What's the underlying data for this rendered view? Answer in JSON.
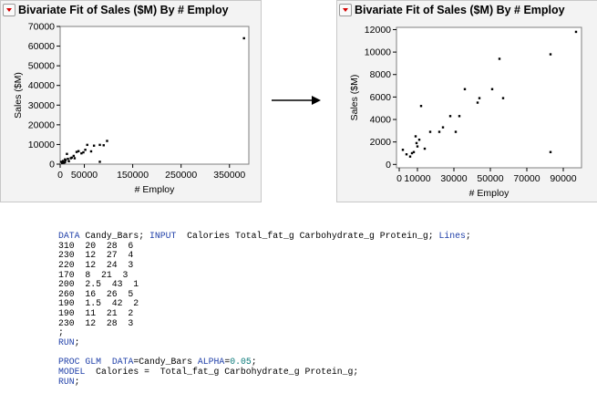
{
  "chart_data": [
    {
      "type": "scatter",
      "title": "Bivariate Fit of Sales ($M) By # Employ",
      "xlabel": "# Employ",
      "ylabel": "Sales ($M)",
      "xlim": [
        0,
        390000
      ],
      "ylim": [
        0,
        70000
      ],
      "xticks": [
        0,
        50000,
        150000,
        250000,
        350000
      ],
      "xtick_labels": [
        "0",
        "50000",
        "150000",
        "250000",
        "350000"
      ],
      "yticks": [
        0,
        10000,
        20000,
        30000,
        40000,
        50000,
        60000,
        70000
      ],
      "ytick_labels": [
        "0",
        "10000",
        "20000",
        "30000",
        "40000",
        "50000",
        "60000",
        "70000"
      ],
      "grid": false,
      "series": [
        {
          "x": [
            2000,
            4000,
            5000,
            6000,
            8000,
            10000,
            10000,
            11000,
            14000,
            16000,
            18000,
            22000,
            24000,
            28000,
            30000,
            34000,
            38000,
            44000,
            48000,
            52000,
            56000,
            64000,
            70000,
            82000,
            82000,
            90000,
            97000,
            380000
          ],
          "y": [
            1200,
            600,
            800,
            1600,
            700,
            1000,
            2400,
            2000,
            5200,
            2700,
            1500,
            3000,
            3300,
            4200,
            3000,
            6200,
            6600,
            5500,
            6000,
            7300,
            9800,
            6500,
            9400,
            9800,
            1200,
            9600,
            11800,
            64000
          ]
        }
      ]
    },
    {
      "type": "scatter",
      "title": "Bivariate Fit of Sales ($M) By # Employ",
      "xlabel": "# Employ",
      "ylabel": "Sales ($M)",
      "xlim": [
        -1500,
        100000
      ],
      "ylim": [
        -300,
        12200
      ],
      "xticks": [
        0,
        10000,
        30000,
        50000,
        70000,
        90000
      ],
      "xtick_labels": [
        "0",
        "10000",
        "30000",
        "50000",
        "70000",
        "90000"
      ],
      "yticks": [
        0,
        2000,
        4000,
        6000,
        8000,
        10000,
        12000
      ],
      "ytick_labels": [
        "0",
        "2000",
        "4000",
        "6000",
        "8000",
        "10000",
        "12000"
      ],
      "grid": false,
      "series": [
        {
          "x": [
            2000,
            4000,
            6000,
            7000,
            8000,
            9000,
            9500,
            10000,
            11000,
            12000,
            14000,
            17000,
            22000,
            24000,
            28000,
            31000,
            33000,
            36000,
            43000,
            44000,
            51000,
            55000,
            57000,
            83000,
            83000,
            97000
          ],
          "y": [
            1300,
            900,
            700,
            1000,
            1100,
            2500,
            1900,
            1600,
            2200,
            5200,
            1400,
            2900,
            2900,
            3300,
            4300,
            2900,
            4300,
            6700,
            5500,
            5900,
            6700,
            9400,
            5900,
            9800,
            1100,
            11800
          ]
        }
      ]
    }
  ],
  "arrow": {
    "name": "transform-arrow"
  },
  "code_lines": [
    [
      [
        "kw",
        "DATA"
      ],
      [
        "t",
        " Candy_Bars; "
      ],
      [
        "kw",
        "INPUT"
      ],
      [
        "t",
        "  Calories Total_fat_g Carbohydrate_g Protein_g; "
      ],
      [
        "kw",
        "Lines"
      ],
      [
        "t",
        ";"
      ]
    ],
    [
      [
        "t",
        "310  20  28  6"
      ]
    ],
    [
      [
        "t",
        "230  12  27  4"
      ]
    ],
    [
      [
        "t",
        "220  12  24  3"
      ]
    ],
    [
      [
        "t",
        "170  8  21  3"
      ]
    ],
    [
      [
        "t",
        "200  2.5  43  1"
      ]
    ],
    [
      [
        "t",
        "260  16  26  5"
      ]
    ],
    [
      [
        "t",
        "190  1.5  42  2"
      ]
    ],
    [
      [
        "t",
        "190  11  21  2"
      ]
    ],
    [
      [
        "t",
        "230  12  28  3"
      ]
    ],
    [
      [
        "t",
        ";"
      ]
    ],
    [
      [
        "kw",
        "RUN"
      ],
      [
        "t",
        ";"
      ]
    ],
    [
      [
        "t",
        ""
      ]
    ],
    [
      [
        "kw",
        "PROC GLM"
      ],
      [
        "t",
        "  "
      ],
      [
        "kw",
        "DATA"
      ],
      [
        "t",
        "=Candy_Bars "
      ],
      [
        "kw",
        "ALPHA"
      ],
      [
        "t",
        "="
      ],
      [
        "num",
        "0.05"
      ],
      [
        "t",
        ";"
      ]
    ],
    [
      [
        "kw",
        "MODEL"
      ],
      [
        "t",
        "  Calories =  Total_fat_g Carbohydrate_g Protein_g;"
      ]
    ],
    [
      [
        "kw",
        "RUN"
      ],
      [
        "t",
        ";"
      ]
    ]
  ]
}
